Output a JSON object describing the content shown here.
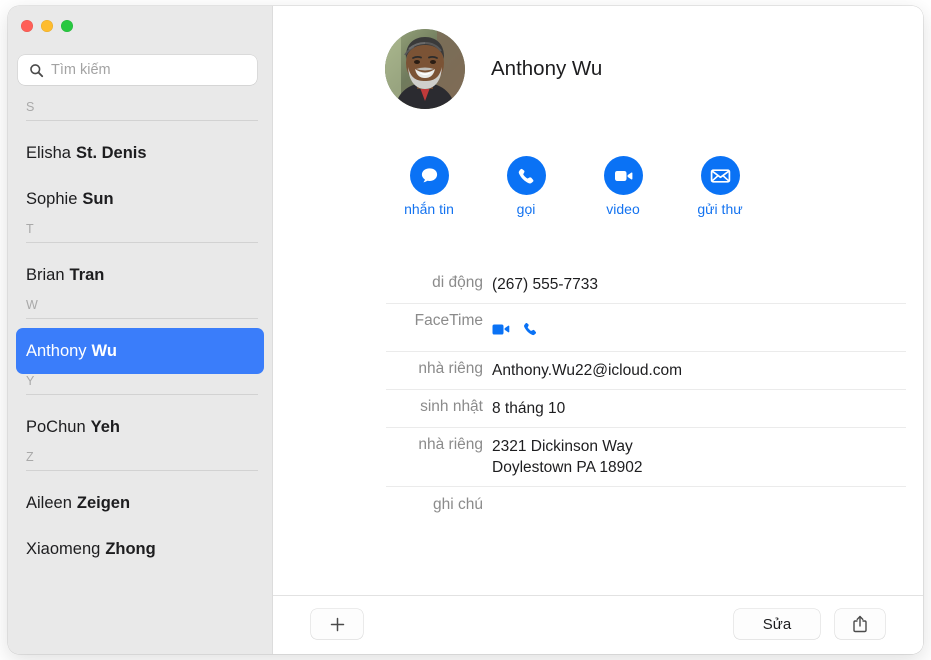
{
  "window": {
    "traffic_lights": [
      {
        "name": "close",
        "color": "#ff5f57"
      },
      {
        "name": "minimize",
        "color": "#febc2e"
      },
      {
        "name": "zoom",
        "color": "#28c840"
      }
    ]
  },
  "search": {
    "placeholder": "Tìm kiếm",
    "value": "",
    "icon": "search-icon"
  },
  "sidebar": {
    "groups": [
      {
        "letter": "S",
        "contacts": [
          {
            "first": "Elisha",
            "last": "St. Denis",
            "selected": false
          },
          {
            "first": "Sophie",
            "last": "Sun",
            "selected": false
          }
        ]
      },
      {
        "letter": "T",
        "contacts": [
          {
            "first": "Brian",
            "last": "Tran",
            "selected": false
          }
        ]
      },
      {
        "letter": "W",
        "contacts": [
          {
            "first": "Anthony",
            "last": "Wu",
            "selected": true
          }
        ]
      },
      {
        "letter": "Y",
        "contacts": [
          {
            "first": "PoChun",
            "last": "Yeh",
            "selected": false
          }
        ]
      },
      {
        "letter": "Z",
        "contacts": [
          {
            "first": "Aileen",
            "last": "Zeigen",
            "selected": false
          },
          {
            "first": "Xiaomeng",
            "last": "Zhong",
            "selected": false
          }
        ]
      }
    ],
    "selection_color": "#3a7dfa",
    "background_color": "#e9e9e9"
  },
  "detail": {
    "contact_name": "Anthony Wu",
    "avatar": "contact-photo",
    "accent_color": "#0a72f5",
    "actions": [
      {
        "label": "nhắn tin",
        "icon": "message-icon"
      },
      {
        "label": "gọi",
        "icon": "phone-icon"
      },
      {
        "label": "video",
        "icon": "video-icon"
      },
      {
        "label": "gửi thư",
        "icon": "mail-icon"
      }
    ],
    "fields": [
      {
        "label": "di động",
        "value": "(267) 555-7733",
        "type": "text"
      },
      {
        "label": "FaceTime",
        "value": "",
        "type": "facetime",
        "icons": [
          "video-icon",
          "phone-icon"
        ]
      },
      {
        "label": "nhà riêng",
        "value": "Anthony.Wu22@icloud.com",
        "type": "text"
      },
      {
        "label": "sinh nhật",
        "value": "8 tháng 10",
        "type": "text"
      },
      {
        "label": "nhà riêng",
        "type": "address",
        "address_line1": "2321 Dickinson Way",
        "address_line2": "Doylestown PA 18902",
        "trailing_icon": "map-pin-icon"
      },
      {
        "label": "ghi chú",
        "value": "",
        "type": "text"
      }
    ]
  },
  "toolbar": {
    "add_label": "+",
    "add_icon": "plus-icon",
    "edit_label": "Sửa",
    "share_icon": "share-icon"
  }
}
